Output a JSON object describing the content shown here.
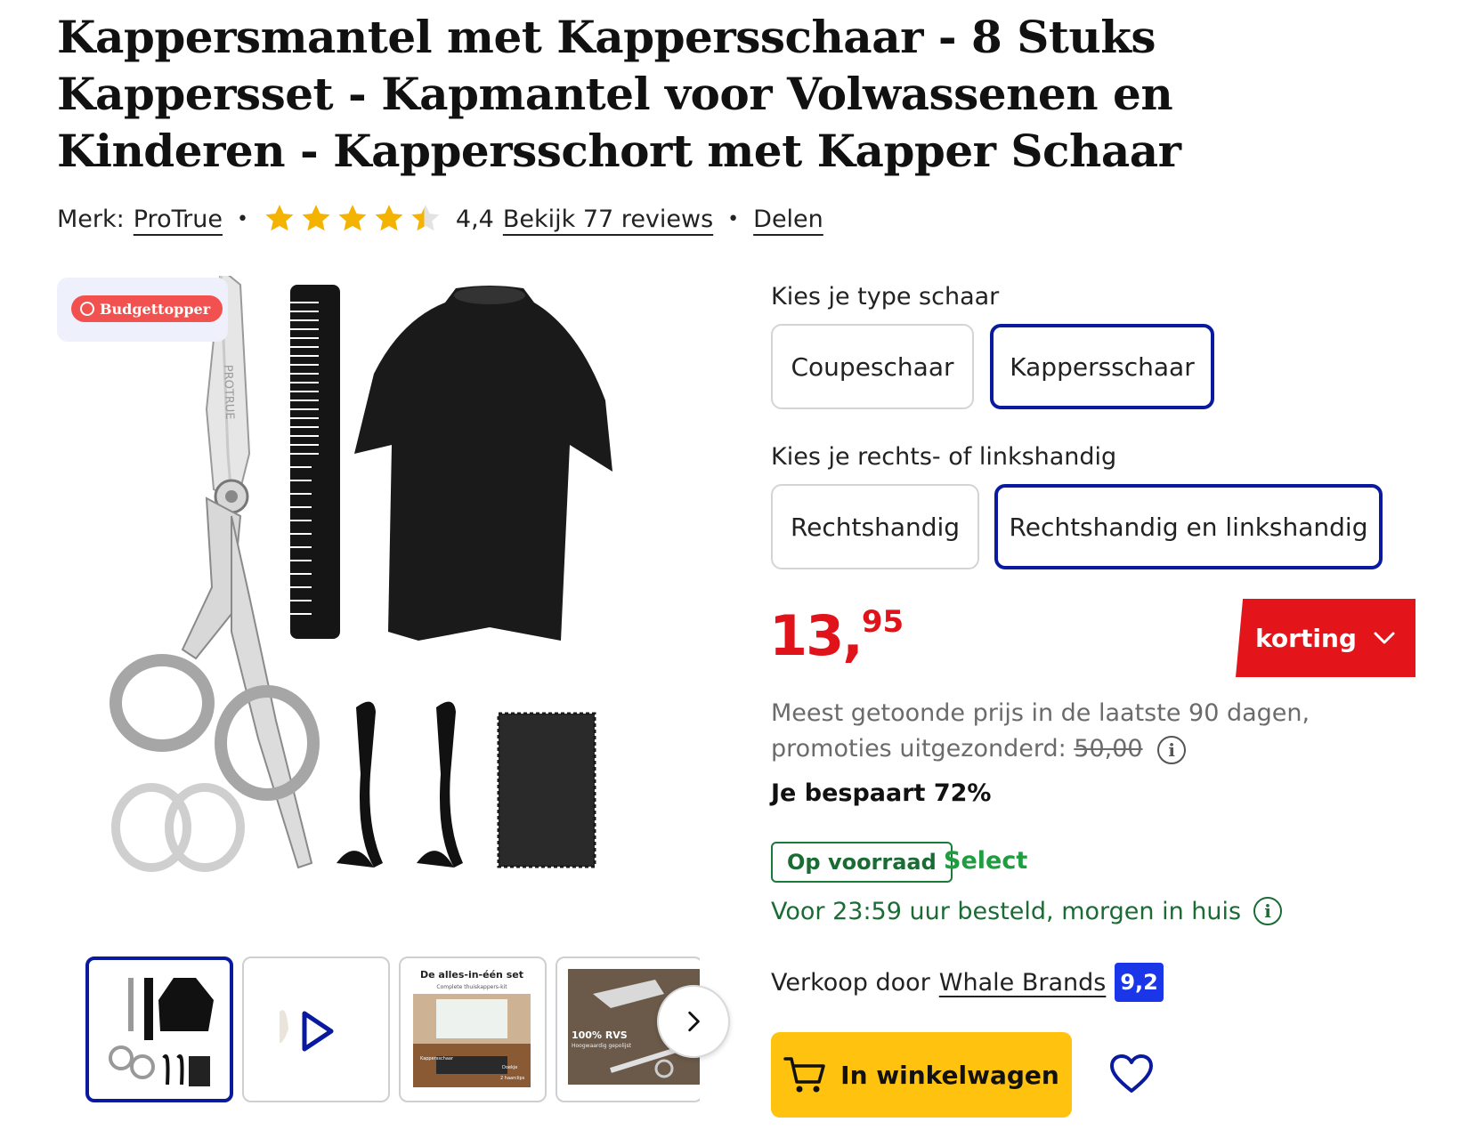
{
  "product": {
    "title": "Kappersmantel met Kappersschaar - 8 Stuks Kappersset - Kapmantel voor Volwassenen en Kinderen - Kappersschort met Kapper Schaar",
    "brand_label": "Merk:",
    "brand": "ProTrue",
    "rating_value": 4.4,
    "rating_text": "4,4",
    "reviews_link": "Bekijk 77 reviews",
    "share": "Delen",
    "badge": "Budgettopper",
    "image_brand_text": "PROTRUE"
  },
  "thumbnails": [
    {
      "name": "thumb-main",
      "active": true
    },
    {
      "name": "thumb-video",
      "active": false
    },
    {
      "title": "De alles-in-één set",
      "subtitle": "Complete thuiskappers-kit",
      "labels": [
        "Kappersschaar",
        "Doekje",
        "2 haarclips"
      ]
    },
    {
      "title": "100% RVS",
      "subtitle": "Hoogwaardig gepolijst"
    }
  ],
  "options": {
    "scissors_label": "Kies je type schaar",
    "scissors": [
      {
        "label": "Coupeschaar",
        "selected": false
      },
      {
        "label": "Kappersschaar",
        "selected": true
      }
    ],
    "hand_label": "Kies je rechts- of linkshandig",
    "hand": [
      {
        "label": "Rechtshandig",
        "selected": false
      },
      {
        "label": "Rechtshandig en linkshandig",
        "selected": true
      }
    ]
  },
  "pricing": {
    "price_int": "13",
    "price_dec": "95",
    "discount_button": "korting",
    "ref_text": "Meest getoonde prijs in de laatste 90 dagen, promoties uitgezonderd:",
    "ref_price": "50,00",
    "savings": "Je bespaart 72%"
  },
  "availability": {
    "stock": "Op voorraad",
    "select": "Select",
    "delivery": "Voor 23:59 uur besteld, morgen in huis"
  },
  "seller": {
    "label": "Verkoop door",
    "name": "Whale Brands",
    "score": "9,2"
  },
  "actions": {
    "cart": "In winkelwagen"
  },
  "colors": {
    "accent_blue": "#0a1a9e",
    "price_red": "#e0131a",
    "cart_yellow": "#ffc20e",
    "stock_green": "#1b6b35",
    "star_gold": "#f5b301"
  }
}
